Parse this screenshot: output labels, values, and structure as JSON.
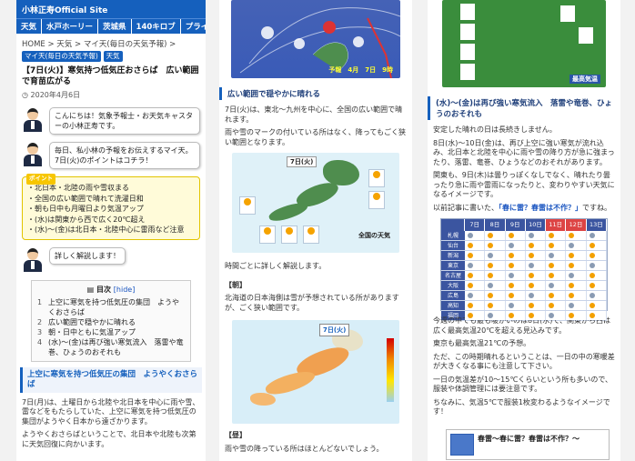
{
  "site": {
    "title": "小林正寿Official Site"
  },
  "nav": [
    "天気",
    "水戸ホーリー",
    "茨城県",
    "140キロブ",
    "プライ"
  ],
  "breadcrumb": {
    "text": "HOME > 天気 > マイ天(毎日の天気予報) >",
    "tag_1": "マイ天(毎日の天気予報)",
    "tag_2": "天気"
  },
  "post": {
    "title": "【7日(火)】寒気持つ低気圧おさらば　広い範囲で育苗広がる",
    "date": "2020年4月6日",
    "greeting": "こんにちは！気象予報士・お天気キャスターの小林正寿です。",
    "intro": "毎日、私小林の予報をお伝えするマイ天。7日(火)のポイントはコチラ！",
    "points_tag": "ポイント",
    "points": [
      "・北日本・北陸の雨や雪収まる",
      "・全国の広い範囲で晴れて洗濯日和",
      "・朝も日中も月曜日より気温アップ",
      "・(水)は関東から西で広く20℃超え",
      "・(水)〜(金)は北日本・北陸中心に雷雨など注意"
    ],
    "detail": "詳しく解説します！",
    "toc": {
      "title": "目次",
      "hide": "[hide]",
      "items": [
        "上空に寒気を持つ低気圧の集団　ようやくおさらば",
        "広い範囲で穏やかに晴れる",
        "朝・日中ともに気温アップ",
        "(水)〜(金)は再び強い寒気流入　落雷や竜巻、ひょうのおそれも"
      ]
    },
    "section1_title": "上空に寒気を持つ低気圧の集団　ようやくおさらば",
    "section1_p1": "7日(月)は、土曜日から北陸や北日本を中心に雨や雪、雷などをもたらしていた、上空に寒気を持つ低気圧の集団がようやく日本から遠ざかります。",
    "section1_p2": "ようやくおさらばということで、北日本や北陸も次第に天気回復に向かいます。"
  },
  "col2": {
    "weather_map_caption": "予報　4月　7日　9時",
    "section2_title": "広い範囲で穏やかに晴れる",
    "section2_p1": "7日(火)は、東北〜九州を中心に、全国の広い範囲で晴れます。",
    "section2_p2": "雨や雪のマークの付いている所はなく、降ってもごく狭い範囲となります。",
    "forecast_map_tag": "7日(火)",
    "forecast_map_caption": "全国の天気",
    "time_note": "時間ごとに詳しく解説します。",
    "morning_label": "【朝】",
    "morning_text": "北海道の日本海側は雪が予想されている所がありますが、ごく狭い範囲です。",
    "radar_tag": "7日(火)",
    "noon_label": "【昼】",
    "noon_text": "雨や雪の降っている所はほとんどないでしょう。"
  },
  "col3": {
    "map_caption": "最高気温",
    "section4_title": "(水)〜(金)は再び強い寒気流入　落雷や竜巻、ひょうのおそれも",
    "p1": "安定した晴れの日は長続きしません。",
    "p2": "8日(水)〜10日(金)は、再び上空に強い寒気が流れ込み、北日本と北陸を中心に雨や雪の降り方が急に強まったり、落雷、竜巻、ひょうなどのおそれがあります。",
    "p3": "関東も、9日(木)は曇りっぽくなしでなく、晴れたり曇ったり急に雨や雷雨になったりと、変わりやすい天気になるイメージです。",
    "p4_prefix": "以前記事に書いた、",
    "p4_link": "「春に雷？春雷は不作？」",
    "p4_suffix": "ですね。",
    "grid_days": [
      "7日",
      "8日",
      "9日",
      "10日",
      "11日",
      "12日",
      "13日"
    ],
    "grid_cities": [
      "札幌",
      "仙台",
      "新潟",
      "東京",
      "名古屋",
      "大阪",
      "広島",
      "高知",
      "福岡"
    ],
    "p5": "今週の中でも最も暖かいのは8日(水)で、関東から西は広く最高気温20℃を超える見込みです。",
    "p6": "東京も最高気温21℃の予想。",
    "p7": "ただ、この時期晴れるということは、一日の中の寒暖差が大きくなる事にも注意して下さい。",
    "p8": "一日の気温差が10〜15℃くらいという所も多いので、服装や体調管理には要注意です。",
    "p9": "ちなみに、気温5℃で服装1枚変わるようなイメージです！",
    "related_title": "春雷〜春に雷？春雷は不作？〜"
  }
}
